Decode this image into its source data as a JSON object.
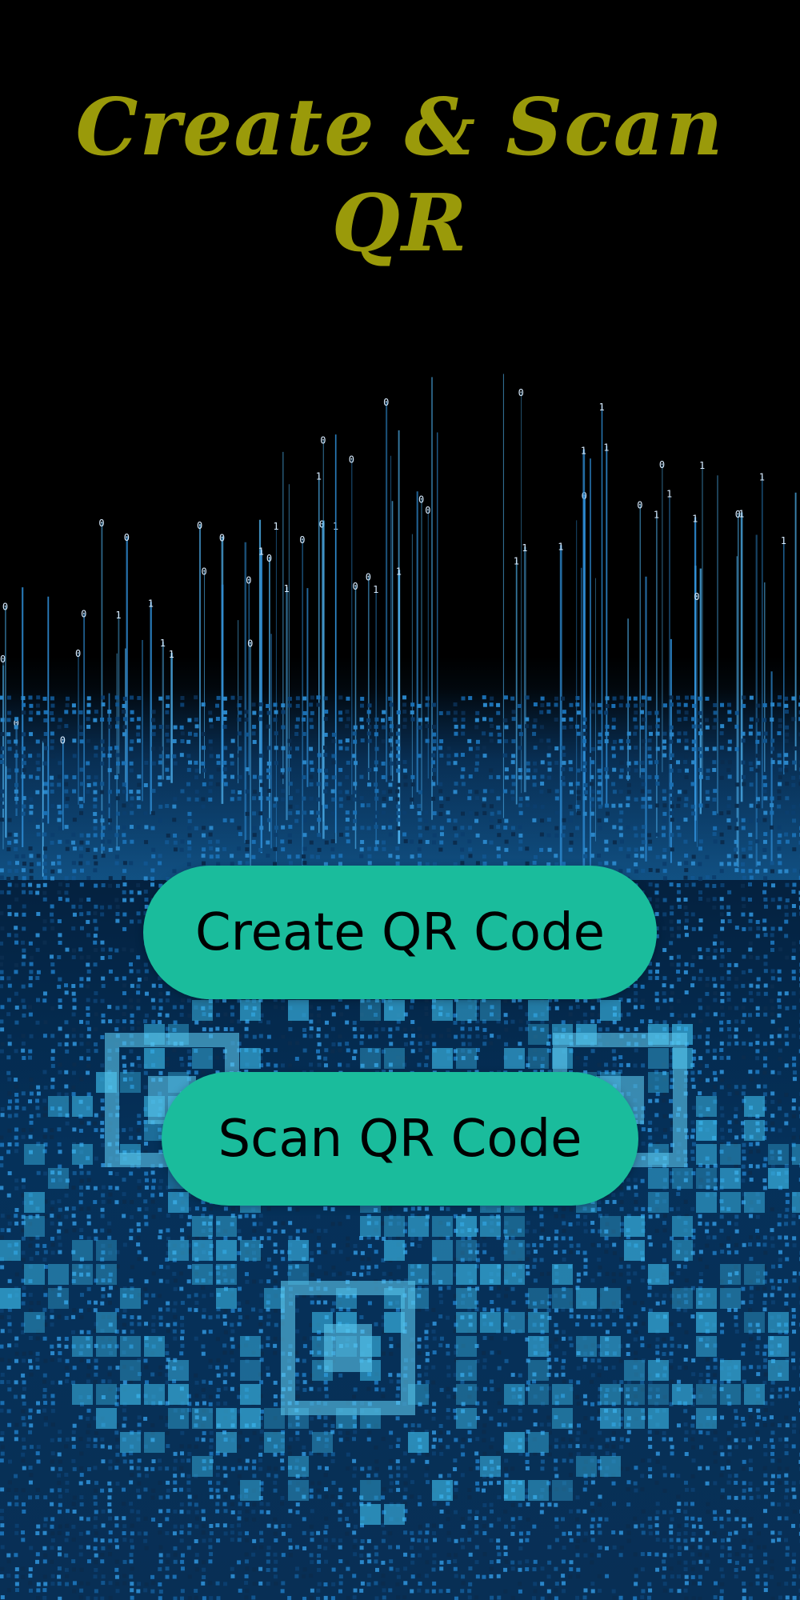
{
  "app": {
    "title": "Create & Scan\nQR",
    "title_color": "#9a9a0a",
    "accent_color": "#1abc9c",
    "background": "digital-qr-code-artwork"
  },
  "buttons": {
    "create_label": "Create QR Code",
    "scan_label": "Scan QR Code"
  }
}
